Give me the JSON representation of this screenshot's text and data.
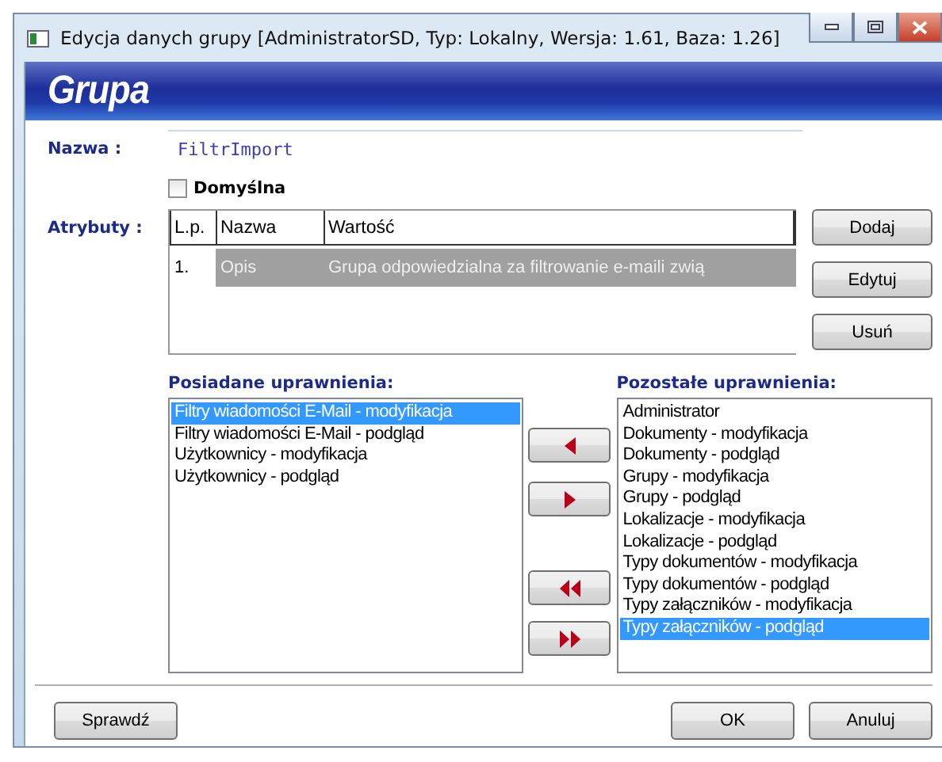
{
  "window": {
    "title": "Edycja danych grupy [AdministratorSD, Typ: Lokalny, Wersja: 1.61, Baza: 1.26]"
  },
  "header": {
    "title": "Grupa"
  },
  "name_field": {
    "label": "Nazwa :",
    "value": "FiltrImport"
  },
  "default_checkbox": {
    "label": "Domyślna",
    "checked": false
  },
  "attributes": {
    "label": "Atrybuty :",
    "columns": [
      "L.p.",
      "Nazwa",
      "Wartość"
    ],
    "rows": [
      {
        "cells": [
          "1.",
          "Opis",
          "Grupa odpowiedzialna za filtrowanie e-maili zwią"
        ],
        "selected": true
      }
    ],
    "buttons": [
      "Dodaj",
      "Edytuj",
      "Usuń"
    ]
  },
  "owned_permissions": {
    "label": "Posiadane uprawnienia:",
    "items": [
      {
        "label": "Filtry wiadomości E-Mail - modyfikacja",
        "selected": true
      },
      {
        "label": "Filtry wiadomości E-Mail - podgląd",
        "selected": false
      },
      {
        "label": "Użytkownicy - modyfikacja",
        "selected": false
      },
      {
        "label": "Użytkownicy - podgląd",
        "selected": false
      }
    ]
  },
  "transfer_buttons": [
    {
      "kind": "left"
    },
    {
      "kind": "right"
    },
    {
      "kind": "all-left"
    },
    {
      "kind": "all-right"
    }
  ],
  "other_permissions": {
    "label": "Pozostałe uprawnienia:",
    "items": [
      {
        "label": "Administrator",
        "selected": false
      },
      {
        "label": "Dokumenty - modyfikacja",
        "selected": false
      },
      {
        "label": "Dokumenty - podgląd",
        "selected": false
      },
      {
        "label": "Grupy - modyfikacja",
        "selected": false
      },
      {
        "label": "Grupy - podgląd",
        "selected": false
      },
      {
        "label": "Lokalizacje - modyfikacja",
        "selected": false
      },
      {
        "label": "Lokalizacje - podgląd",
        "selected": false
      },
      {
        "label": "Typy dokumentów - modyfikacja",
        "selected": false
      },
      {
        "label": "Typy dokumentów - podgląd",
        "selected": false
      },
      {
        "label": "Typy załączników - modyfikacja",
        "selected": false
      },
      {
        "label": "Typy załączników - podgląd",
        "selected": true
      }
    ]
  },
  "footer_buttons": {
    "left": [
      "Sprawdź"
    ],
    "right": [
      "OK",
      "Anuluj"
    ]
  }
}
